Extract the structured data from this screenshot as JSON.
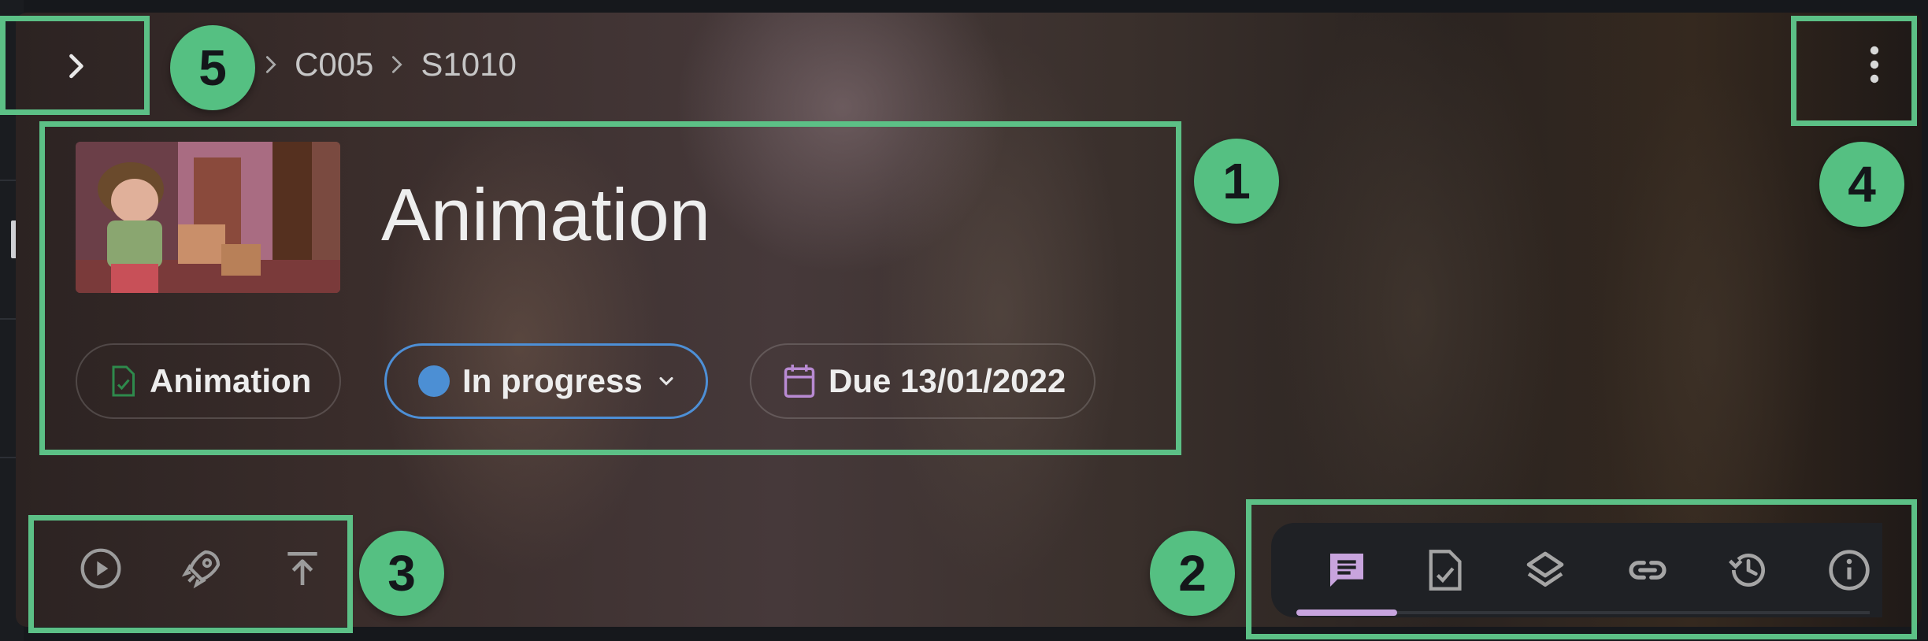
{
  "breadcrumb": {
    "items": [
      "C005",
      "S1010"
    ]
  },
  "task": {
    "title": "Animation",
    "type_label": "Animation",
    "status_label": "In progress",
    "due_label": "Due 13/01/2022"
  },
  "colors": {
    "highlight": "#5cc086",
    "status_in_progress": "#4c8fd4",
    "active_tab": "#c8a4de",
    "task_type_icon": "#2e8a4c",
    "due_icon": "#b88ad2"
  },
  "callouts": [
    "1",
    "2",
    "3",
    "4",
    "5"
  ],
  "toolbar": {
    "icons": [
      "play-circle-icon",
      "rocket-icon",
      "publish-icon"
    ]
  },
  "tabs": [
    "comments-icon",
    "task-check-icon",
    "layers-icon",
    "link-icon",
    "history-icon",
    "info-icon"
  ],
  "menu_icon": "more-vertical-icon",
  "expand_icon": "chevron-right-icon"
}
